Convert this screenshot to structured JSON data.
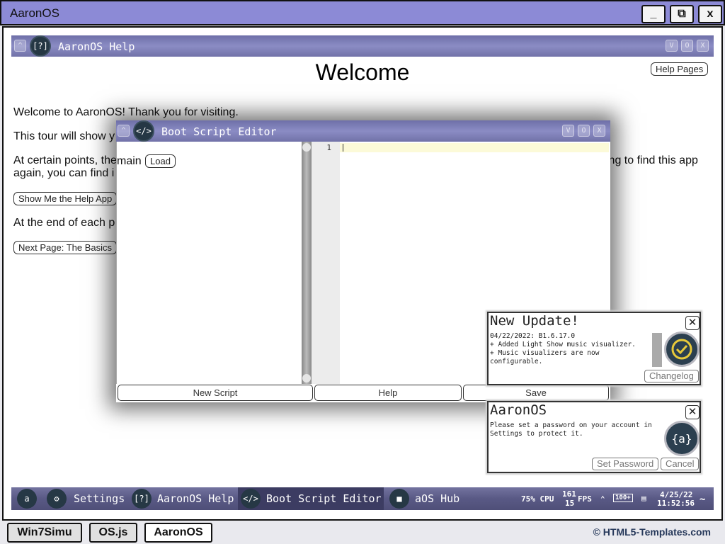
{
  "browser": {
    "title": "AaronOS",
    "minimize": "_",
    "restore": "⧉",
    "close": "x"
  },
  "help_window": {
    "title": "AaronOS Help",
    "heading": "Welcome",
    "help_pages_button": "Help Pages",
    "paragraphs": [
      "Welcome to AaronOS! Thank you for visiting.",
      "This tour will show y",
      "At certain points, the main",
      "again, you can find i",
      "At the end of each p"
    ],
    "para_right_fragment": "ing to find this app",
    "show_me_button": "Show Me the Help App",
    "next_page_button": "Next Page: The Basics"
  },
  "boot_script_editor": {
    "title": "Boot Script Editor",
    "load_button": "Load",
    "line_number": "1",
    "buttons": {
      "new_script": "New Script",
      "help": "Help",
      "save": "Save"
    }
  },
  "notifications": {
    "update": {
      "title": "New Update!",
      "lines": [
        "04/22/2022: B1.6.17.0",
        "+ Added Light Show music visualizer.",
        "+ Music visualizers are now",
        "configurable."
      ],
      "changelog_button": "Changelog"
    },
    "password": {
      "title": "AaronOS",
      "lines": [
        "Please set a password on your account in",
        "Settings to protect it."
      ],
      "set_password_button": "Set Password",
      "cancel_button": "Cancel"
    }
  },
  "taskbar": {
    "start_icon": "a",
    "items": [
      {
        "label": "Settings",
        "icon": "gear-icon"
      },
      {
        "label": "AaronOS Help",
        "icon": "help-icon"
      },
      {
        "label": "Boot Script Editor",
        "icon": "code-icon"
      },
      {
        "label": "aOS Hub",
        "icon": "hub-icon"
      }
    ],
    "cpu": "75% CPU",
    "fps_top": "161",
    "fps_bottom": "15",
    "fps_label": "FPS",
    "battery": "100+",
    "date": "4/25/22",
    "time": "11:52:56"
  },
  "bottom_bar": {
    "tabs": [
      "Win7Simu",
      "OS.js",
      "AaronOS"
    ],
    "copyright": "© HTML5-Templates.com"
  },
  "colors": {
    "titlebar": "#8c8ad6",
    "window_title": "#7b7cb6",
    "taskbar": "#595985",
    "icon_bg": "#263845"
  }
}
